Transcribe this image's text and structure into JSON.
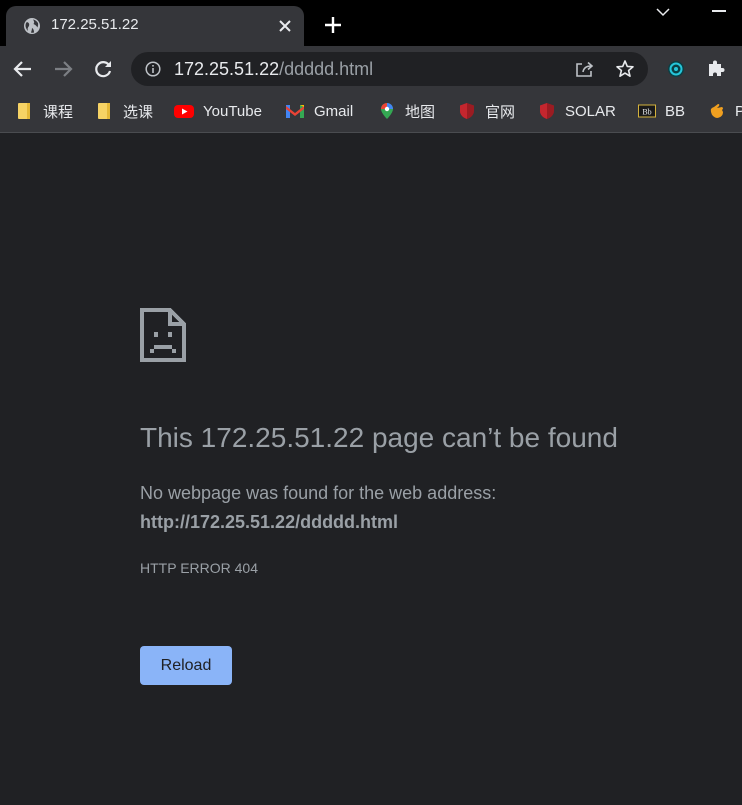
{
  "tab": {
    "title": "172.25.51.22",
    "favicon": "globe-icon"
  },
  "window": {
    "new_tab_icon": "plus-icon",
    "tab_search_icon": "chevron-down-icon",
    "minimize_icon": "minimize-icon"
  },
  "toolbar": {
    "back_icon": "arrow-left-icon",
    "forward_icon": "arrow-right-icon",
    "reload_icon": "reload-icon",
    "url_host": "172.25.51.22",
    "url_path": "/ddddd.html",
    "share_icon": "share-icon",
    "bookmark_icon": "star-icon",
    "extension_icon": "puzzle-icon"
  },
  "bookmarks": [
    {
      "label": "课程",
      "icon": "folder-icon"
    },
    {
      "label": "选课",
      "icon": "folder-icon"
    },
    {
      "label": "YouTube",
      "icon": "youtube-icon"
    },
    {
      "label": "Gmail",
      "icon": "gmail-icon"
    },
    {
      "label": "地图",
      "icon": "maps-icon"
    },
    {
      "label": "官网",
      "icon": "shield-icon"
    },
    {
      "label": "SOLAR",
      "icon": "shield-icon"
    },
    {
      "label": "BB",
      "icon": "blackboard-icon"
    },
    {
      "label": "P",
      "icon": "hand-icon"
    }
  ],
  "error": {
    "heading": "This 172.25.51.22 page can’t be found",
    "description": "No webpage was found for the web address:",
    "url": "http://172.25.51.22/ddddd.html",
    "code": "HTTP ERROR 404",
    "reload_label": "Reload"
  },
  "colors": {
    "page_background": "#202124",
    "toolbar_background": "#35363a",
    "tabstrip_background": "#000000",
    "muted_text": "#9aa0a6",
    "button_blue": "#8ab4f8"
  }
}
